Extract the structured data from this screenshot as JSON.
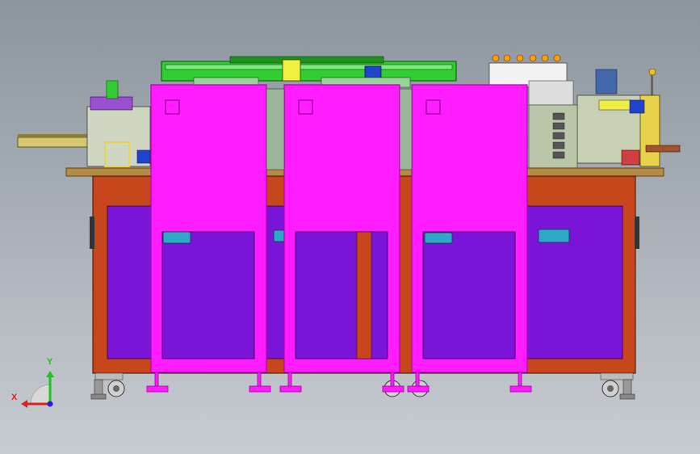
{
  "viewport": {
    "background_top": "#8c959e",
    "background_bottom": "#c7ccd1"
  },
  "colors": {
    "cabinet_magenta": "#ff1dff",
    "cabinet_outline": "#c000c0",
    "panel_purple": "#7a14d6",
    "frame_orange": "#c8461c",
    "tabletop_tan": "#b58a45",
    "access_handle": "#2fa8c8",
    "mechanism_green": "#33cc33",
    "mechanism_blue": "#2244cc",
    "mechanism_yellow": "#e8d24a"
  },
  "model": {
    "cabinets": [
      "left-safety-enclosure",
      "center-safety-enclosure",
      "right-safety-enclosure"
    ],
    "frame_doors": 5,
    "casters": 4
  },
  "axis_triad": {
    "x_label": "X",
    "y_label": "Y",
    "x_color": "#e02020",
    "y_color": "#20c020",
    "z_color": "#2020e0"
  }
}
